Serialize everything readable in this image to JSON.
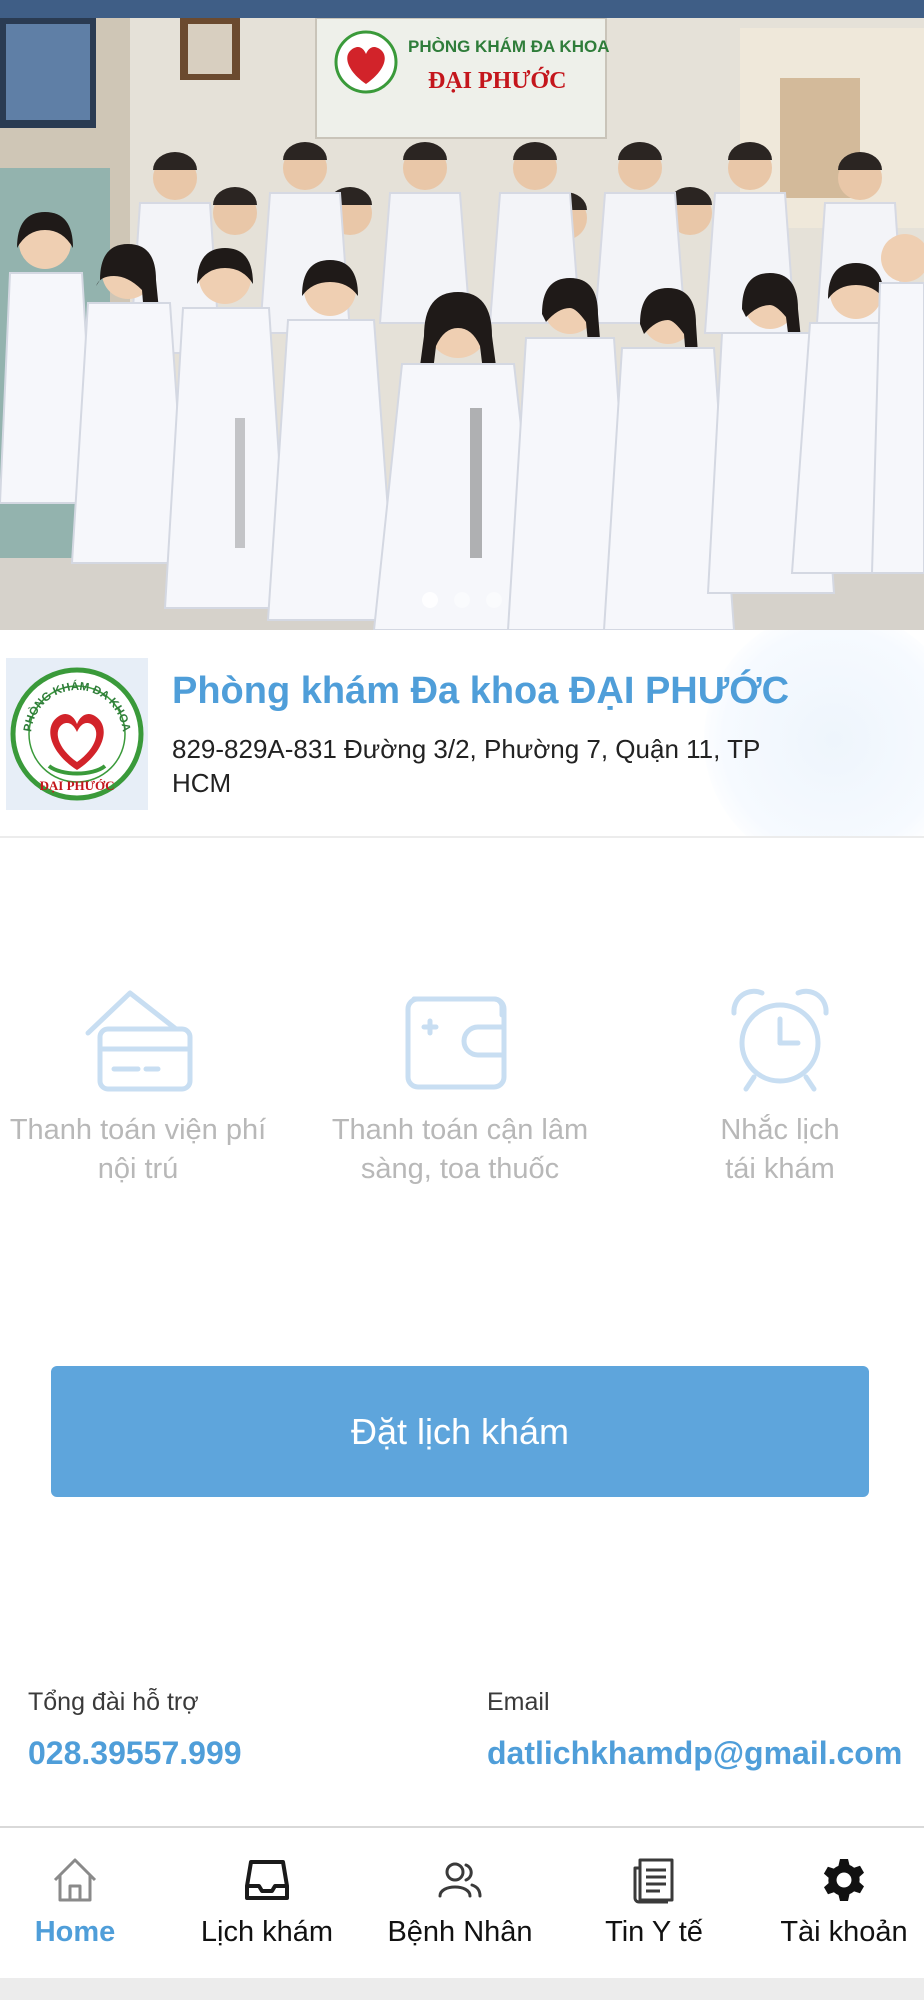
{
  "hero": {
    "sign_line1": "PHÒNG KHÁM ĐA KHOA",
    "sign_line2": "ĐẠI PHƯỚC",
    "slides": 3,
    "active_slide": 1
  },
  "clinic": {
    "name": "Phòng khám Đa khoa ĐẠI PHƯỚC",
    "address": "829-829A-831 Đường 3/2, Phường 7, Quận 11, TP HCM",
    "logo_text_top": "PHÒNG KHÁM ĐA KHOA",
    "logo_text_bottom": "ĐẠI PHƯỚC"
  },
  "services": [
    {
      "icon": "credit-card-icon",
      "line1": "Thanh toán viện phí",
      "line2": "nội trú"
    },
    {
      "icon": "wallet-icon",
      "line1": "Thanh toán cận lâm",
      "line2": "sàng, toa thuốc"
    },
    {
      "icon": "alarm-clock-icon",
      "line1": "Nhắc lịch",
      "line2": "tái khám"
    }
  ],
  "book_button": "Đặt lịch khám",
  "contact": {
    "hotline_label": "Tổng đài hỗ trợ",
    "hotline_value": "028.39557.999",
    "email_label": "Email",
    "email_value": "datlichkhamdp@gmail.com"
  },
  "tabs": [
    {
      "label": "Home",
      "icon": "home-icon",
      "active": true
    },
    {
      "label": "Lịch khám",
      "icon": "inbox-icon",
      "active": false
    },
    {
      "label": "Bệnh Nhân",
      "icon": "patients-icon",
      "active": false
    },
    {
      "label": "Tin Y tế",
      "icon": "news-icon",
      "active": false
    },
    {
      "label": "Tài khoản",
      "icon": "gear-icon",
      "active": false
    }
  ],
  "colors": {
    "accent": "#4f9ed9",
    "button": "#5ea5dc",
    "service_icon": "#c8def2",
    "service_text": "#b8b8b8",
    "logo_red": "#d2232a",
    "logo_green": "#3a9a3a"
  }
}
